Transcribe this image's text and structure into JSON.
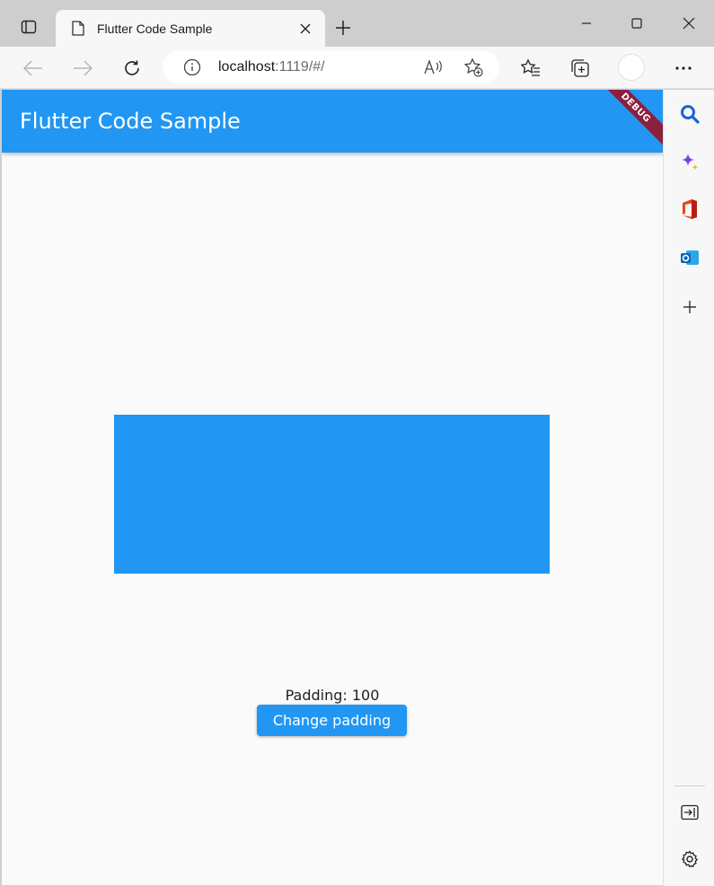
{
  "browser": {
    "tab": {
      "title": "Flutter Code Sample"
    },
    "address_bar": {
      "host": "localhost",
      "rest": ":1119/#/"
    }
  },
  "app": {
    "title": "Flutter Code Sample",
    "debug_banner": "DEBUG",
    "padding_label": "Padding: 100",
    "button_label": "Change padding",
    "colors": {
      "primary": "#2196f3",
      "background": "#fafafa",
      "debug": "#8b1f3c"
    }
  },
  "sidebar": {
    "icons": [
      "search-icon",
      "copilot-icon",
      "office-icon",
      "outlook-icon",
      "add-icon",
      "hide-sidebar-icon",
      "settings-icon"
    ]
  }
}
